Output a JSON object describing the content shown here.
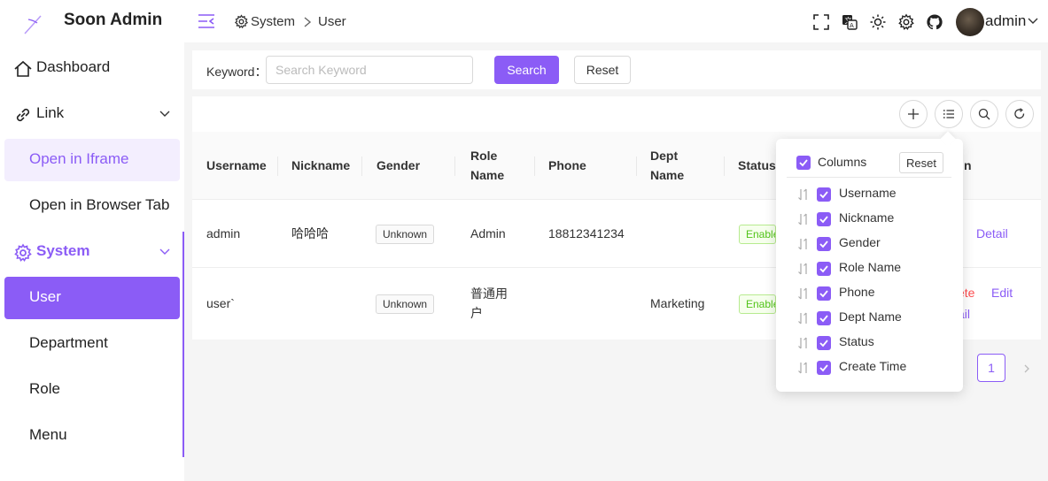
{
  "app": {
    "title": "Soon Admin"
  },
  "sidebar": {
    "items": [
      {
        "label": "Dashboard"
      },
      {
        "label": "Link"
      },
      {
        "label": "Open in Iframe"
      },
      {
        "label": "Open in Browser Tab"
      },
      {
        "label": "System"
      },
      {
        "label": "User"
      },
      {
        "label": "Department"
      },
      {
        "label": "Role"
      },
      {
        "label": "Menu"
      }
    ]
  },
  "header": {
    "breadcrumb": [
      "System",
      "User"
    ],
    "user": "admin"
  },
  "search": {
    "keyword_label": "Keyword：",
    "placeholder": "Search Keyword",
    "search_button": "Search",
    "reset_button": "Reset"
  },
  "table": {
    "headers": [
      "Username",
      "Nickname",
      "Gender",
      "Role Name",
      "Phone",
      "Dept Name",
      "Status",
      "n"
    ],
    "rows": [
      {
        "username": "admin",
        "nickname": "哈哈哈",
        "gender": "Unknown",
        "role": "Admin",
        "phone": "18812341234",
        "dept": "",
        "status": "Enable",
        "actions": [
          "Detail"
        ]
      },
      {
        "username": "user`",
        "nickname": "",
        "gender": "Unknown",
        "role": "普通用户",
        "phone": "",
        "dept": "Marketing",
        "status": "Enable",
        "actions": [
          "ete",
          "Edit",
          "ail"
        ]
      }
    ]
  },
  "pagination": {
    "current": "1"
  },
  "columns_popover": {
    "title": "Columns",
    "reset": "Reset",
    "items": [
      "Username",
      "Nickname",
      "Gender",
      "Role Name",
      "Phone",
      "Dept Name",
      "Status",
      "Create Time"
    ]
  },
  "colors": {
    "accent": "#8b5cf6",
    "danger": "#ff4d4f",
    "success": "#52c41a"
  }
}
